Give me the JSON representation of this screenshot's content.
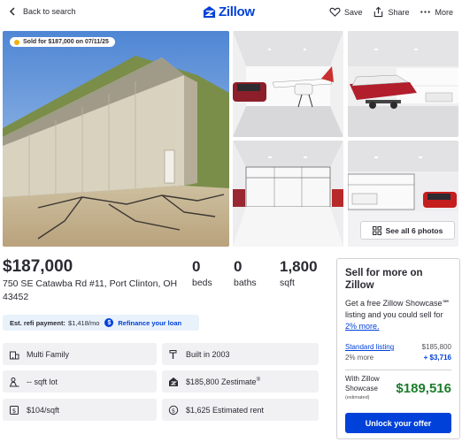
{
  "header": {
    "back_label": "Back to search",
    "logo_text": "Zillow",
    "save_label": "Save",
    "share_label": "Share",
    "more_label": "More"
  },
  "gallery": {
    "sold_badge": "Sold for $187,000 on 07/11/25",
    "see_all_label": "See all 6 photos"
  },
  "listing": {
    "price": "$187,000",
    "address": "750 SE Catawba Rd #11, Port Clinton, OH 43452",
    "beds_num": "0",
    "beds_label": "beds",
    "baths_num": "0",
    "baths_label": "baths",
    "sqft_num": "1,800",
    "sqft_label": "sqft"
  },
  "refi": {
    "label": "Est. refi payment:",
    "amount": "$1,418/mo",
    "icon": "$",
    "link": "Refinance your loan"
  },
  "facts": {
    "type": "Multi Family",
    "built": "Built in 2003",
    "lot": "-- sqft lot",
    "zestimate": "$185,800 Zestimate",
    "zestimate_mark": "®",
    "price_per_sqft": "$104/sqft",
    "rent": "$1,625 Estimated rent"
  },
  "sell": {
    "title": "Sell for more on Zillow",
    "desc": "Get a free Zillow Showcase℠ listing and you could sell for ",
    "desc_more": "2% more.",
    "std_label": "Standard listing",
    "std_value": "$185,800",
    "more_label": "2% more",
    "more_value": "+ $3,716",
    "showcase_label": "With Zillow Showcase",
    "showcase_est": "(estimated)",
    "showcase_value": "$189,516",
    "button": "Unlock your offer"
  },
  "colors": {
    "brand": "#0041d9",
    "price_green": "#1b7d2b",
    "sold_dot": "#f2b10c",
    "fact_bg": "#f1f1f4",
    "refi_bg": "#e9f2fb"
  }
}
